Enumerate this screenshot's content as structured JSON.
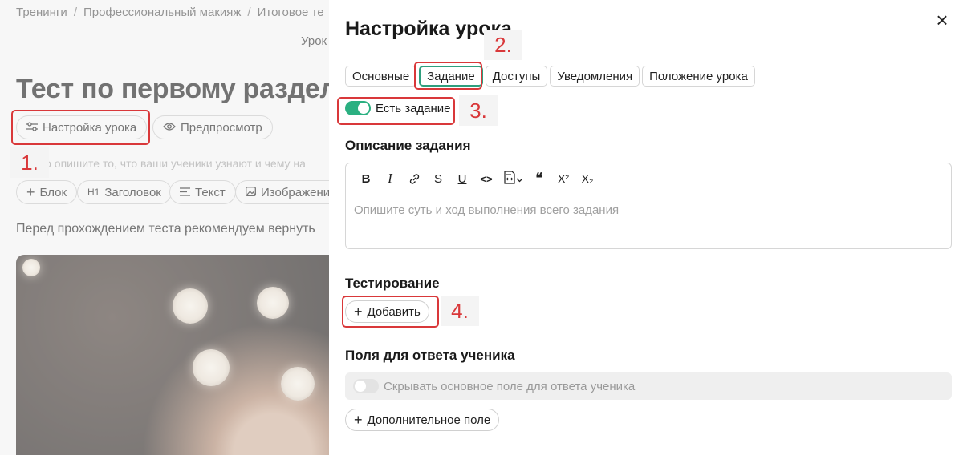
{
  "background": {
    "breadcrumb": [
      "Тренинги",
      "Профессиональный макияж",
      "Итоговое те"
    ],
    "breadcrumb_sep": "/",
    "lesson_label": "Урок",
    "title": "Тест по первому разделу",
    "settings_button": "Настройка урока",
    "preview_button": "Предпросмотр",
    "hint": "Кратко опишите то, что ваши ученики узнают и чему на",
    "blocks": [
      "Блок",
      "Заголовок",
      "Текст",
      "Изображение"
    ],
    "heading_badge": "H1",
    "intro": "Перед прохождением теста рекомендуем вернуть"
  },
  "panel": {
    "title": "Настройка урока",
    "close_glyph": "×",
    "tabs": [
      "Основные",
      "Задание",
      "Доступы",
      "Уведомления",
      "Положение урока"
    ],
    "active_tab": "Задание",
    "has_task_label": "Есть задание",
    "has_task_on": true,
    "description_heading": "Описание задания",
    "editor_placeholder": "Опишите суть и ход выполнения всего задания",
    "toolbar": {
      "bold": "B",
      "italic": "I",
      "strike": "S",
      "underline": "U",
      "code": "<>",
      "quote": "❝",
      "superscript": "X²",
      "subscript": "X₂"
    },
    "testing_heading": "Тестирование",
    "add_button": "Добавить",
    "answer_fields_heading": "Поля для ответа ученика",
    "hide_field_label": "Скрывать основное поле для ответа ученика",
    "hide_field_on": false,
    "extra_field_button": "Дополнительное поле"
  },
  "annotations": [
    "1.",
    "2.",
    "3.",
    "4."
  ],
  "colors": {
    "accent": "#2bb081",
    "annotation": "#d9383a"
  }
}
